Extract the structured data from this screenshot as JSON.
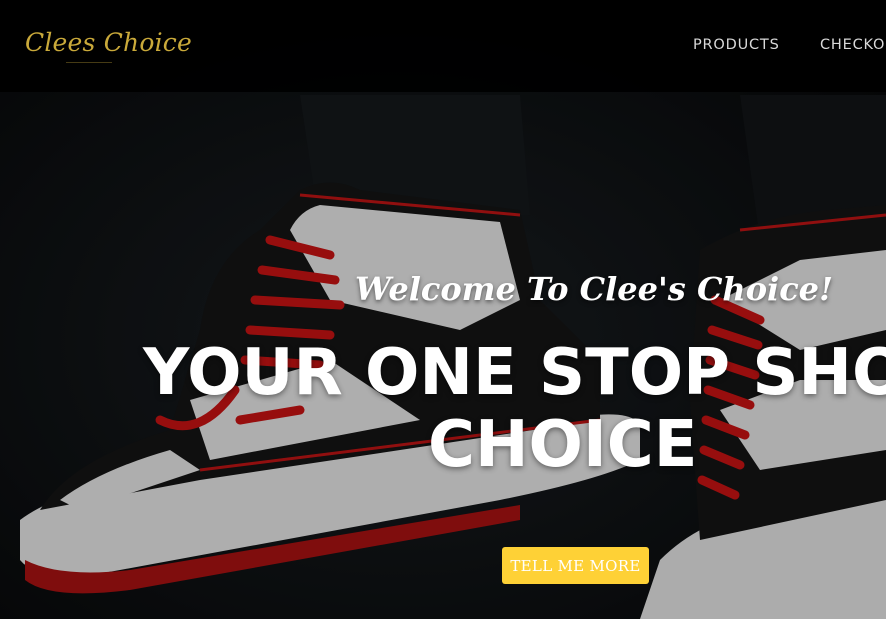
{
  "navbar": {
    "brand": "Clees Choice",
    "items": [
      {
        "label": "PRODUCTS"
      },
      {
        "label": "CHECKOUT"
      }
    ]
  },
  "hero": {
    "subheading": "Welcome To Clee's Choice!",
    "heading_line1": "YOUR ONE STOP SHOP",
    "heading_line2": "CHOICE",
    "cta_label": "TELL ME MORE"
  },
  "colors": {
    "brand": "#c9a93a",
    "accent": "#fed136",
    "shoe_red": "#d11414",
    "navbar_bg": "#000000"
  }
}
